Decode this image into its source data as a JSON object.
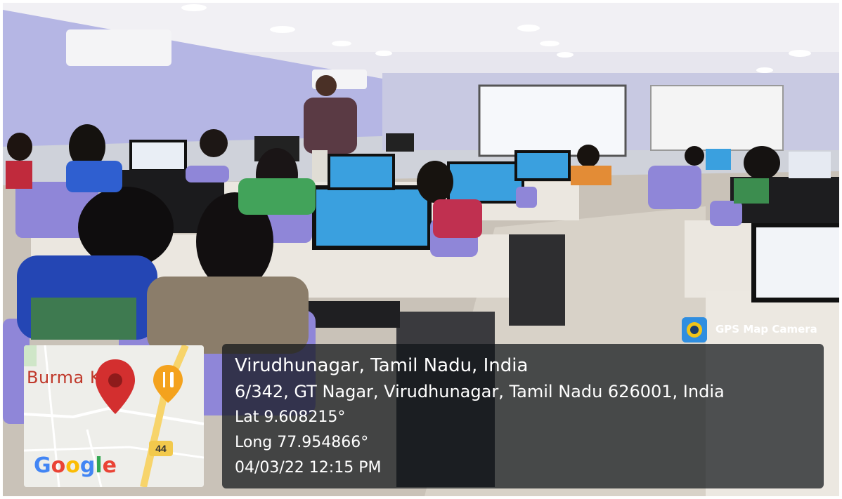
{
  "overlay": {
    "city": "Virudhunagar, Tamil Nadu, India",
    "address": "6/342, GT Nagar, Virudhunagar, Tamil Nadu 626001, India",
    "lat": "Lat 9.608215°",
    "long": "Long 77.954866°",
    "datetime": "04/03/22 12:15 PM"
  },
  "badge": {
    "label": "GPS Map Camera",
    "icon": "gps-camera-icon"
  },
  "map": {
    "place_label": "Burma K",
    "road_number": "44",
    "brand": "Google",
    "icons": [
      "map-pin-icon",
      "restaurant-icon"
    ]
  },
  "colors": {
    "wall": "#b7b9e6",
    "chair": "#8f86d8",
    "desk": "#e9e4dc",
    "screen": "#3aa0df",
    "pin": "#d32f2f",
    "restaurant": "#f4a21d"
  }
}
